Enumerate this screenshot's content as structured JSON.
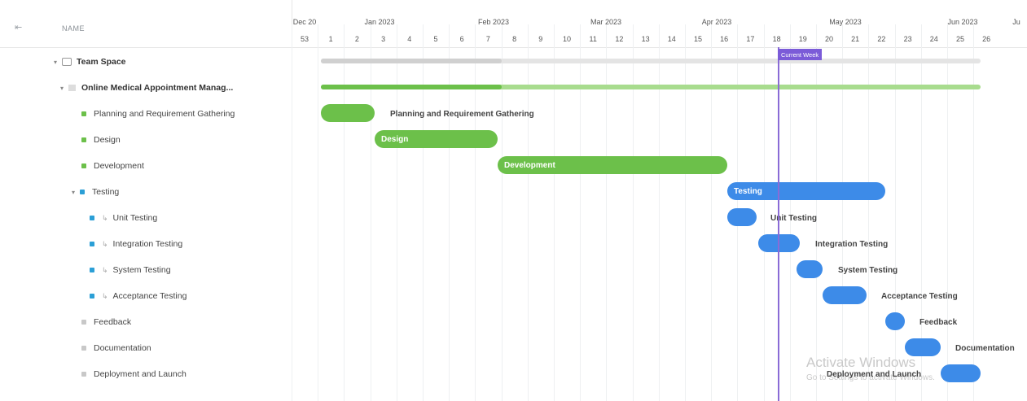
{
  "header": {
    "name_column": "NAME"
  },
  "timeline": {
    "months": [
      "Dec 20",
      "Jan 2023",
      "Feb 2023",
      "Mar 2023",
      "Apr 2023",
      "May 2023",
      "Jun 2023",
      "Ju"
    ],
    "weeks": [
      "53",
      "1",
      "2",
      "3",
      "4",
      "5",
      "6",
      "7",
      "8",
      "9",
      "10",
      "11",
      "12",
      "13",
      "14",
      "15",
      "16",
      "17",
      "18",
      "19",
      "20",
      "21",
      "22",
      "23",
      "24",
      "25",
      "26"
    ],
    "current_week_label": "Current Week"
  },
  "rows": [
    {
      "label": "Team Space"
    },
    {
      "label": "Online Medical Appointment Manag..."
    },
    {
      "label": "Planning and Requirement Gathering"
    },
    {
      "label": "Design"
    },
    {
      "label": "Development"
    },
    {
      "label": "Testing"
    },
    {
      "label": "Unit Testing"
    },
    {
      "label": "Integration Testing"
    },
    {
      "label": "System Testing"
    },
    {
      "label": "Acceptance Testing"
    },
    {
      "label": "Feedback"
    },
    {
      "label": "Documentation"
    },
    {
      "label": "Deployment and Launch"
    }
  ],
  "bars": {
    "planning": "Planning and Requirement Gathering",
    "design": "Design",
    "development": "Development",
    "testing": "Testing",
    "unit": "Unit Testing",
    "integration": "Integration Testing",
    "system": "System Testing",
    "acceptance": "Acceptance Testing",
    "feedback": "Feedback",
    "documentation": "Documentation",
    "deployment": "Deployment and Launch"
  },
  "watermark": {
    "line1": "Activate Windows",
    "line2": "Go to Settings to activate Windows."
  },
  "colors": {
    "green": "#6cc04a",
    "blue": "#3d8be8",
    "current_week": "#7b5bd8"
  }
}
